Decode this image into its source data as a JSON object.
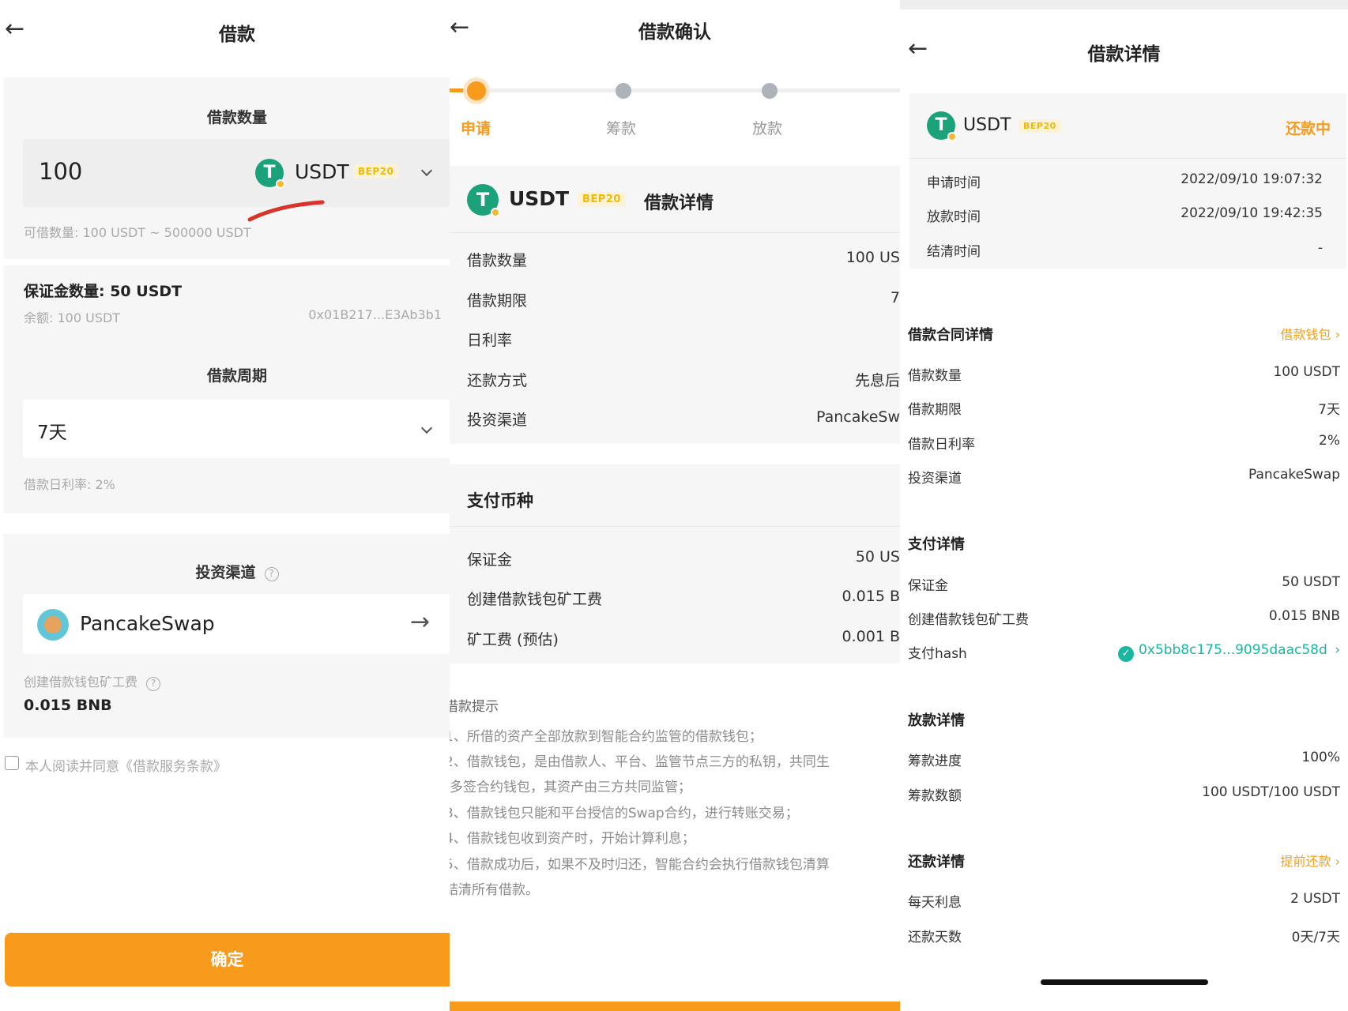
{
  "panel1": {
    "title": "借款",
    "amount_section": "借款数量",
    "amount_value": "100",
    "token": "USDT",
    "network": "BEP20",
    "range_text": "可借数量: 100 USDT ~ 500000 USDT",
    "collateral_text": "保证金数量: 50 USDT",
    "balance_text": "余额: 100 USDT",
    "wallet_address": "0x01B217...E3Ab3b1",
    "period_section": "借款周期",
    "period_value": "7天",
    "daily_rate_text": "借款日利率: 2%",
    "channel_section": "投资渠道",
    "channel_value": "PancakeSwap",
    "gas_label": "创建借款钱包矿工费",
    "gas_value": "0.015 BNB",
    "agree_text": "本人阅读并同意《借款服务条款》",
    "confirm_button": "确定"
  },
  "panel2": {
    "title": "借款确认",
    "steps": [
      "申请",
      "筹款",
      "放款"
    ],
    "token": "USDT",
    "network": "BEP20",
    "detail_title": "借款详情",
    "rows": [
      {
        "label": "借款数量",
        "value": "100 US"
      },
      {
        "label": "借款期限",
        "value": "7"
      },
      {
        "label": "日利率",
        "value": ""
      },
      {
        "label": "还款方式",
        "value": "先息后"
      },
      {
        "label": "投资渠道",
        "value": "PancakeSw"
      }
    ],
    "pay_title": "支付币种",
    "pay_rows": [
      {
        "label": "保证金",
        "value": "50 US"
      },
      {
        "label": "创建借款钱包矿工费",
        "value": "0.015 B"
      },
      {
        "label": "矿工费 (预估)",
        "value": "0.001 B"
      }
    ],
    "tips_title": "借款提示",
    "tips": [
      "1、所借的资产全部放款到智能合约监管的借款钱包；",
      "2、借款钱包，是由借款人、平台、监管节点三方的私钥，共同生",
      "多签合约钱包，其资产由三方共同监管；",
      "3、借款钱包只能和平台授信的Swap合约，进行转账交易；",
      "4、借款钱包收到资产时，开始计算利息；",
      "5、借款成功后，如果不及时归还，智能合约会执行借款钱包清算",
      "结清所有借款。"
    ]
  },
  "panel3": {
    "title": "借款详情",
    "token": "USDT",
    "network": "BEP20",
    "status": "还款中",
    "time_rows": [
      {
        "label": "申请时间",
        "value": "2022/09/10 19:07:32"
      },
      {
        "label": "放款时间",
        "value": "2022/09/10 19:42:35"
      },
      {
        "label": "结清时间",
        "value": "-"
      }
    ],
    "contract_title": "借款合同详情",
    "contract_link": "借款钱包",
    "contract_rows": [
      {
        "label": "借款数量",
        "value": "100 USDT"
      },
      {
        "label": "借款期限",
        "value": "7天"
      },
      {
        "label": "借款日利率",
        "value": "2%"
      },
      {
        "label": "投资渠道",
        "value": "PancakeSwap"
      }
    ],
    "pay_title": "支付详情",
    "pay_rows": [
      {
        "label": "保证金",
        "value": "50 USDT"
      },
      {
        "label": "创建借款钱包矿工费",
        "value": "0.015 BNB"
      }
    ],
    "hash_label": "支付hash",
    "hash_value": "0x5bb8c175...9095daac58d",
    "release_title": "放款详情",
    "release_rows": [
      {
        "label": "筹款进度",
        "value": "100%"
      },
      {
        "label": "筹款数额",
        "value": "100 USDT/100 USDT"
      }
    ],
    "repay_title": "还款详情",
    "repay_link": "提前还款",
    "repay_rows": [
      {
        "label": "每天利息",
        "value": "2 USDT"
      },
      {
        "label": "还款天数",
        "value": "0天/7天"
      }
    ]
  },
  "colors": {
    "accent": "#f89a1c",
    "token_green": "#1ba27a",
    "badge_yellow": "#f0b90b",
    "hash_teal": "#19b7a0"
  }
}
